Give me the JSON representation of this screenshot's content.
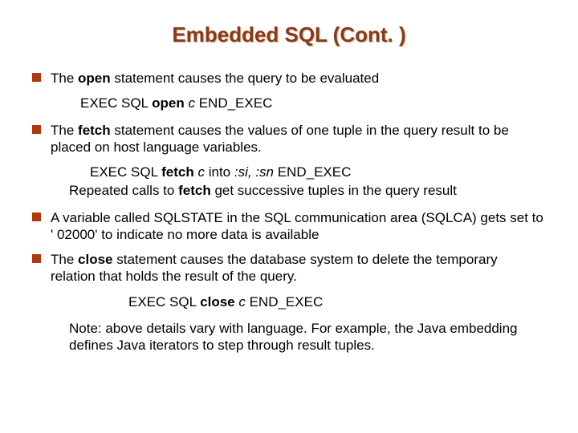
{
  "title": "Embedded SQL (Cont. )",
  "b1": {
    "pre": "The ",
    "kw": "open",
    "post": " statement causes the query to be evaluated"
  },
  "code1": {
    "a": "EXEC SQL ",
    "kw": "open",
    "it": " c ",
    "b": "END_EXEC"
  },
  "b2": {
    "pre": "The ",
    "kw": "fetch",
    "post": " statement causes the values of one tuple in the query result to be placed on host language variables."
  },
  "code2": {
    "a": "EXEC SQL ",
    "kw": "fetch",
    "it1": " c ",
    "mid": "into ",
    "it2": ":si, :sn ",
    "b": "END_EXEC"
  },
  "rep": {
    "a": "Repeated calls to ",
    "kw": "fetch",
    "b": " get successive tuples in the query result"
  },
  "b3": "A variable called SQLSTATE in the SQL communication area (SQLCA) gets set to ' 02000' to indicate no more data is available",
  "b4": {
    "pre": "The ",
    "kw": "close",
    "post": " statement causes the database system to delete the temporary relation that holds the result of the query."
  },
  "code3": {
    "a": "EXEC SQL ",
    "kw": "close",
    "it": " c ",
    "b": "END_EXEC"
  },
  "note": "Note: above details vary with language.  For example, the Java embedding defines Java iterators to step through result tuples."
}
